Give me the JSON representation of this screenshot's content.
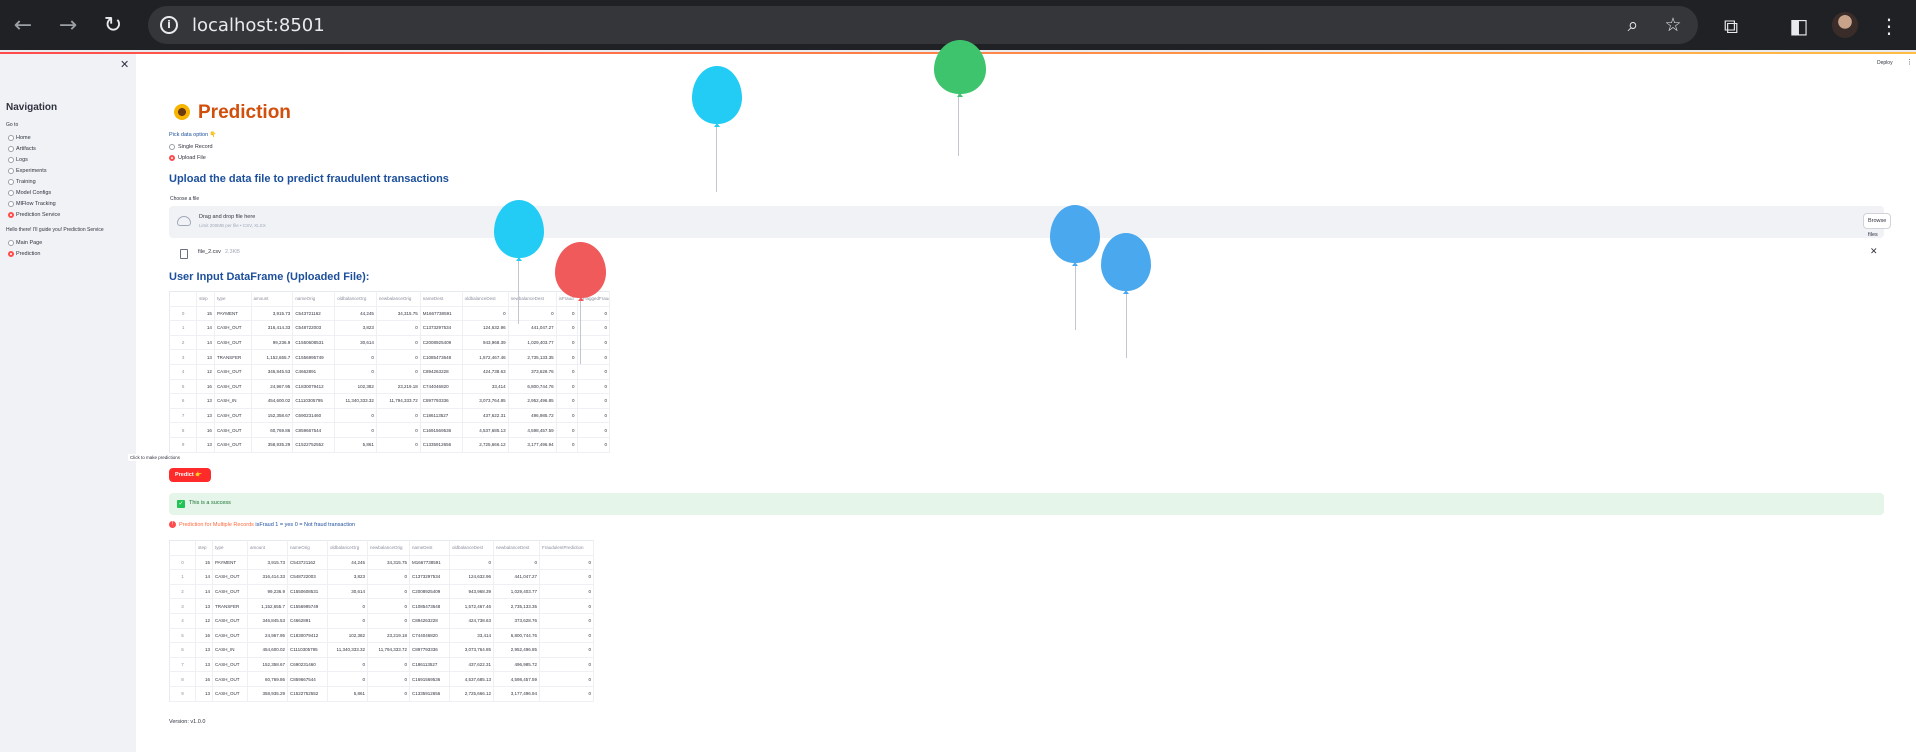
{
  "browser": {
    "url": "localhost:8501"
  },
  "sidebar": {
    "title": "Navigation",
    "goto_label": "Go to",
    "items": [
      {
        "label": "Home",
        "selected": false
      },
      {
        "label": "Artifacts",
        "selected": false
      },
      {
        "label": "Logs",
        "selected": false
      },
      {
        "label": "Experiments",
        "selected": false
      },
      {
        "label": "Training",
        "selected": false
      },
      {
        "label": "Model Configs",
        "selected": false
      },
      {
        "label": "MlFlow Tracking",
        "selected": false
      },
      {
        "label": "Prediction Service",
        "selected": true
      }
    ],
    "guide_label": "Hello there! I'll guide you! Prediction Service",
    "guide_items": [
      {
        "label": "Main Page",
        "selected": false
      },
      {
        "label": "Prediction",
        "selected": true
      }
    ]
  },
  "header": {
    "deploy_label": "Deploy",
    "kebab_icon": "vertical-dots-icon"
  },
  "main": {
    "title": "Prediction",
    "data_option_label": "Pick data option 👇",
    "data_options": [
      {
        "label": "Single Record",
        "selected": false
      },
      {
        "label": "Upload File",
        "selected": true
      }
    ],
    "upload_heading": "Upload the data file to predict fraudulent transactions",
    "choose_label": "Choose a file",
    "dropzone": {
      "main": "Drag and drop file here",
      "sub": "Limit 200MB per file • CSV, XLSX",
      "browse_label": "Browse files"
    },
    "file": {
      "name": "file_2.csv",
      "size": "2.3KB"
    },
    "input_heading": "User Input DataFrame (Uploaded File):",
    "input_table": {
      "columns": [
        "",
        "step",
        "type",
        "amount",
        "nameOrig",
        "oldbalanceOrg",
        "newbalanceOrig",
        "nameDest",
        "oldbalanceDest",
        "newbalanceDest",
        "isFraud",
        "isFlaggedFraud"
      ],
      "rows": [
        [
          "0",
          "15",
          "PAYMENT",
          "3,915.73",
          "C543721162",
          "44,245",
          "34,315.75",
          "M1667738591",
          "0",
          "0",
          "0",
          "0"
        ],
        [
          "1",
          "14",
          "CASH_OUT",
          "316,414.33",
          "C548722003",
          "3,823",
          "0",
          "C1373297534",
          "124,632.96",
          "441,047.27",
          "0",
          "0"
        ],
        [
          "2",
          "14",
          "CASH_OUT",
          "99,236.9",
          "C1550608531",
          "30,614",
          "0",
          "C2008925409",
          "943,968.39",
          "1,029,403.77",
          "0",
          "0"
        ],
        [
          "3",
          "13",
          "TRANSFER",
          "1,152,655.7",
          "C1556995749",
          "0",
          "0",
          "C1085473648",
          "1,572,467.46",
          "2,735,133.35",
          "0",
          "0"
        ],
        [
          "4",
          "12",
          "CASH_OUT",
          "346,845.53",
          "C4662891",
          "0",
          "0",
          "C894263228",
          "424,738.63",
          "373,628.76",
          "0",
          "0"
        ],
        [
          "5",
          "16",
          "CASH_OUT",
          "24,967.95",
          "C1830079412",
          "102,382",
          "23,219.18",
          "C744046820",
          "33,414",
          "6,800,744.76",
          "0",
          "0"
        ],
        [
          "6",
          "13",
          "CASH_IN",
          "454,600.02",
          "C1110305795",
          "11,340,333.32",
          "11,794,333.72",
          "C897793336",
          "3,073,764.85",
          "2,952,496.85",
          "0",
          "0"
        ],
        [
          "7",
          "13",
          "CASH_OUT",
          "152,358.67",
          "C690231460",
          "0",
          "0",
          "C186113527",
          "437,622.31",
          "496,985.72",
          "0",
          "0"
        ],
        [
          "8",
          "16",
          "CASH_OUT",
          "60,769.86",
          "C859667544",
          "0",
          "0",
          "C1691569536",
          "4,537,685.13",
          "4,598,457.59",
          "0",
          "0"
        ],
        [
          "9",
          "13",
          "CASH_OUT",
          "358,935.29",
          "C1522752552",
          "5,861",
          "0",
          "C1335912656",
          "2,725,666.12",
          "3,177,496.94",
          "0",
          "0"
        ]
      ]
    },
    "tooltip": "Click to make predictions",
    "predict_label": "Predict 👉",
    "success_text": "This is a success",
    "prediction_text_1": "Prediction for Multiple Records ",
    "prediction_text_2": "isFraud 1 = yes 0 = Not fraud transaction",
    "output_table": {
      "columns": [
        "",
        "step",
        "type",
        "amount",
        "nameOrig",
        "oldbalanceOrg",
        "newbalanceOrig",
        "nameDest",
        "oldbalanceDest",
        "newbalanceDest",
        "FraudulentPrediction"
      ],
      "rows": [
        [
          "0",
          "15",
          "PAYMENT",
          "3,915.73",
          "C543721162",
          "44,245",
          "34,315.75",
          "M1667738591",
          "0",
          "0",
          "0"
        ],
        [
          "1",
          "14",
          "CASH_OUT",
          "316,414.33",
          "C548722003",
          "3,823",
          "0",
          "C1373297534",
          "124,632.96",
          "441,047.27",
          "0"
        ],
        [
          "2",
          "14",
          "CASH_OUT",
          "99,236.9",
          "C1550608531",
          "30,614",
          "0",
          "C2008925409",
          "943,968.39",
          "1,029,403.77",
          "0"
        ],
        [
          "3",
          "13",
          "TRANSFER",
          "1,152,655.7",
          "C1556995749",
          "0",
          "0",
          "C1085473648",
          "1,572,467.46",
          "2,735,133.35",
          "0"
        ],
        [
          "4",
          "12",
          "CASH_OUT",
          "346,845.53",
          "C4662891",
          "0",
          "0",
          "C894263228",
          "424,738.63",
          "373,628.76",
          "0"
        ],
        [
          "5",
          "16",
          "CASH_OUT",
          "24,967.95",
          "C1830079412",
          "102,382",
          "23,219.18",
          "C744046820",
          "33,414",
          "6,800,744.76",
          "0"
        ],
        [
          "6",
          "13",
          "CASH_IN",
          "454,600.02",
          "C1110305795",
          "11,340,333.32",
          "11,794,333.72",
          "C897793336",
          "3,073,764.85",
          "2,952,496.85",
          "0"
        ],
        [
          "7",
          "13",
          "CASH_OUT",
          "152,358.67",
          "C690231460",
          "0",
          "0",
          "C186113527",
          "437,622.31",
          "496,985.72",
          "0"
        ],
        [
          "8",
          "16",
          "CASH_OUT",
          "60,769.86",
          "C859667544",
          "0",
          "0",
          "C1691569536",
          "4,537,685.13",
          "4,598,457.59",
          "0"
        ],
        [
          "9",
          "13",
          "CASH_OUT",
          "358,935.29",
          "C1522752552",
          "5,861",
          "0",
          "C1335912656",
          "2,725,666.12",
          "3,177,496.94",
          "0"
        ]
      ]
    },
    "version": "Version: v1.0.0"
  },
  "colors": {
    "accent": "#ff4b4b",
    "title": "#d14e0b",
    "heading": "#1c4f9c",
    "success_bg": "#e6f5e9",
    "balloon_blue": "#22ccf5",
    "balloon_green": "#3ec46d",
    "balloon_red": "#f05a5b",
    "balloon_steel": "#4aa8ef"
  }
}
